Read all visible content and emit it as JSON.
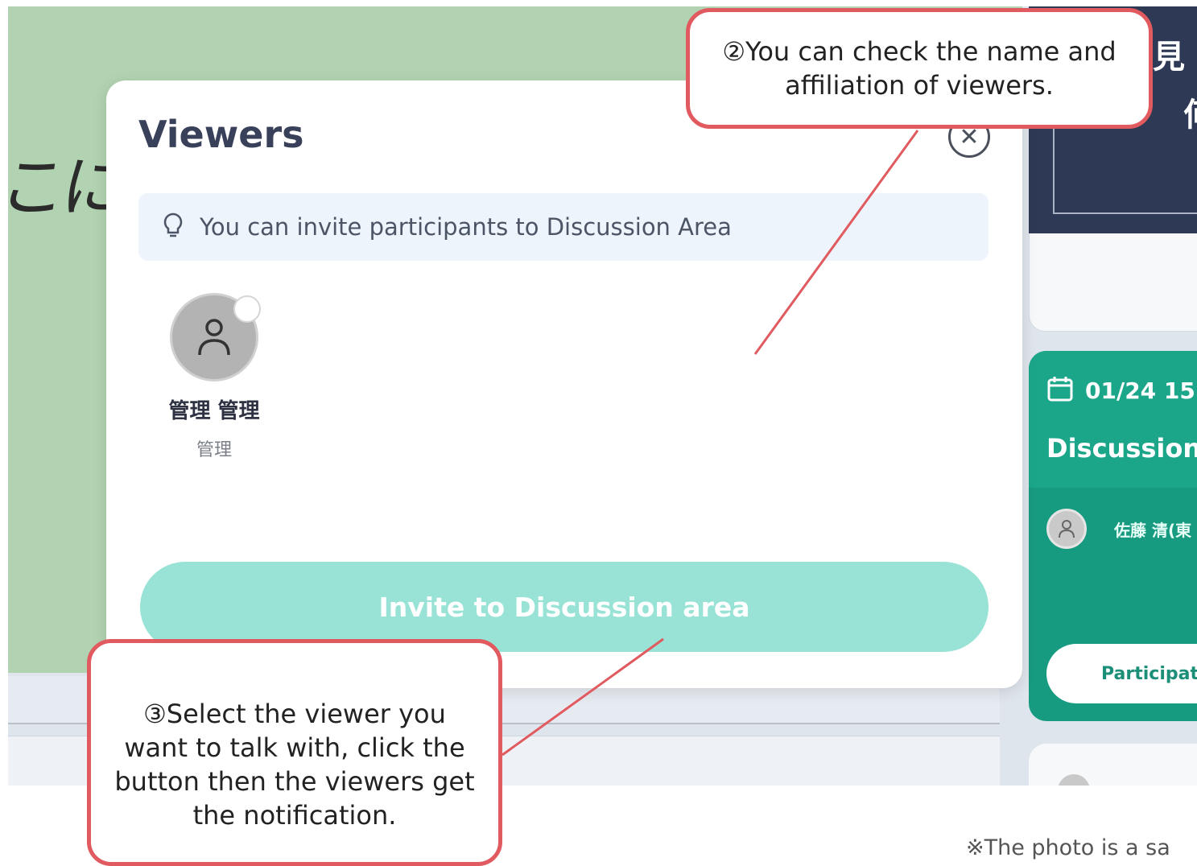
{
  "background": {
    "handwriting": "こに",
    "right_panel_text_1": "見",
    "right_panel_text_2": "何"
  },
  "modal": {
    "title": "Viewers",
    "close_icon": "close-circle-icon",
    "hint_icon": "lightbulb-icon",
    "hint_text": "You can invite participants to Discussion Area",
    "viewers": [
      {
        "name": "管理 管理",
        "affiliation": "管理",
        "selected": false
      }
    ],
    "invite_button_label": "Invite to Discussion area",
    "invite_button_state": "disabled"
  },
  "right_card": {
    "date": "01/24 15",
    "title": "Discussion",
    "participant_name": "佐藤 清(東",
    "button_label": "Participat"
  },
  "callouts": {
    "viewer_info": "②You can check the name and affiliation of viewers.",
    "invite": "③Select the viewer you want to talk with, click the button then the viewers get the notification."
  },
  "footnote": "※The photo is a sa",
  "colors": {
    "callout_border": "#e05a60",
    "invite_button": "#98e3d5",
    "card_teal": "#169a80",
    "green_bg": "#b2d3b1",
    "dark_panel": "#2e3a55"
  }
}
